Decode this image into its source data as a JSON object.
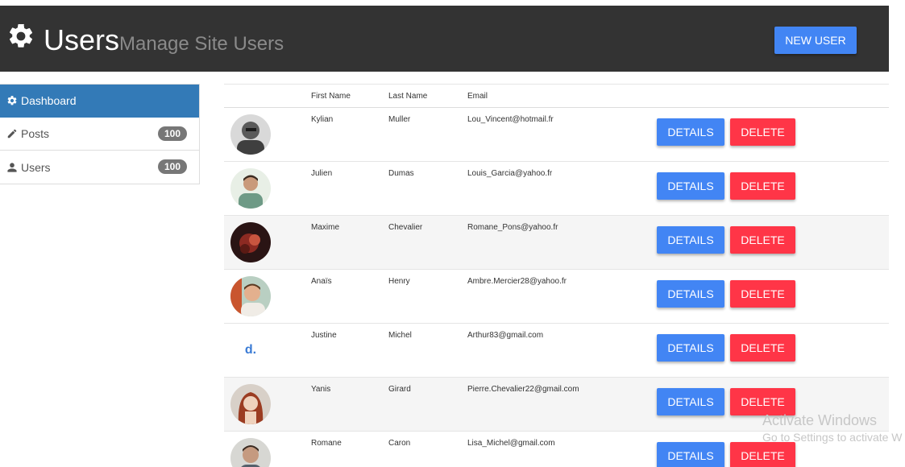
{
  "header": {
    "title": "Users",
    "subtitle": "Manage Site Users",
    "new_user_label": "NEW USER",
    "icon": "gear-icon",
    "background": "#333333"
  },
  "sidebar": {
    "items": [
      {
        "label": "Dashboard",
        "icon": "gear-icon",
        "active": true
      },
      {
        "label": "Posts",
        "icon": "pencil-icon",
        "count": "100"
      },
      {
        "label": "Users",
        "icon": "user-icon",
        "count": "100"
      }
    ],
    "active_color": "#337ab7"
  },
  "table": {
    "columns": [
      "First Name",
      "Last Name",
      "Email"
    ],
    "details_label": "DETAILS",
    "delete_label": "DELETE",
    "details_color": "#4285f4",
    "delete_color": "#ff3547",
    "rows": [
      {
        "first": "Kylian",
        "last": "Muller",
        "email": "Lou_Vincent@hotmail.fr"
      },
      {
        "first": "Julien",
        "last": "Dumas",
        "email": "Louis_Garcia@yahoo.fr"
      },
      {
        "first": "Maxime",
        "last": "Chevalier",
        "email": "Romane_Pons@yahoo.fr"
      },
      {
        "first": "Anaïs",
        "last": "Henry",
        "email": "Ambre.Mercier28@yahoo.fr"
      },
      {
        "first": "Justine",
        "last": "Michel",
        "email": "Arthur83@gmail.com",
        "avatar_text": "d."
      },
      {
        "first": "Yanis",
        "last": "Girard",
        "email": "Pierre.Chevalier22@gmail.com"
      },
      {
        "first": "Romane",
        "last": "Caron",
        "email": "Lisa_Michel@gmail.com"
      }
    ]
  },
  "watermark": {
    "line1": "Activate Windows",
    "line2": "Go to Settings to activate W"
  }
}
